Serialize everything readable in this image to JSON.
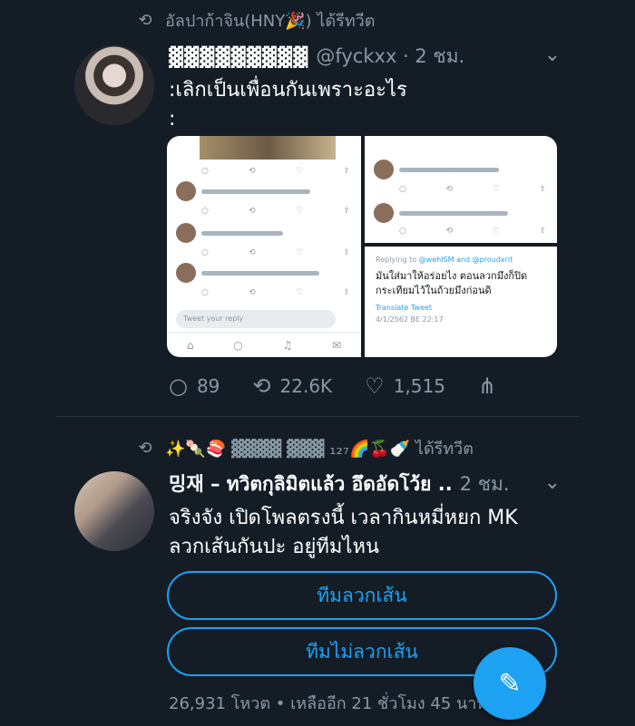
{
  "tweet1": {
    "retweeter": "อัลปาก้าจิน(HNY🎉) ได้รีทวีต",
    "display_name": "▓▓▓▓▓▓▓▓▓",
    "handle_time": "@fyckxx · 2 ชม.",
    "text_line1": ":เลิกเป็นเพื่อนกันเพราะอะไร",
    "text_line2": ":",
    "media": {
      "reply_placeholder": "Tweet your reply",
      "replying_to": "Replying to ",
      "replying_handles": "@wehISM and @proudxrit",
      "reply_text": "มันใส่มาให้อร่อยไง ตอนลวกมึงก็ปิดกระเทียมไว้ในถ้วยมึงก่อนดิ",
      "translate": "Translate Tweet",
      "date": "4/1/2562 BE 22:17"
    },
    "replies": "89",
    "retweets": "22.6K",
    "likes": "1,515"
  },
  "tweet2": {
    "retweeter": "✨🍡🍣 ▓▓▓▓ ▓▓▓ ₁₂₇🌈🍒🍼 ได้รีทวีต",
    "display_name": "밍재 – ทวิตกุลิมิตแล้ว อึดอัดโว้ย ..",
    "time": "2 ชม.",
    "text_line1": "จริงจัง เปิดโพลตรงนี้ เวลากินหมี่หยก MK",
    "text_line2": "ลวกเส้นกันปะ อยู่ทีมไหน",
    "poll_option1": "ทีมลวกเส้น",
    "poll_option2": "ทีมไม่ลวกเส้น",
    "poll_meta": "26,931 โหวต • เหลืออีก 21 ชั่วโมง 45 นาที"
  },
  "icons": {
    "retweet": "retweet-icon",
    "chevron": "chevron-down-icon",
    "reply": "reply-icon",
    "heart": "heart-icon",
    "share": "share-icon",
    "compose": "compose-icon"
  },
  "colors": {
    "background": "#141d26",
    "accent": "#1da1f2",
    "muted": "#8899a6"
  }
}
